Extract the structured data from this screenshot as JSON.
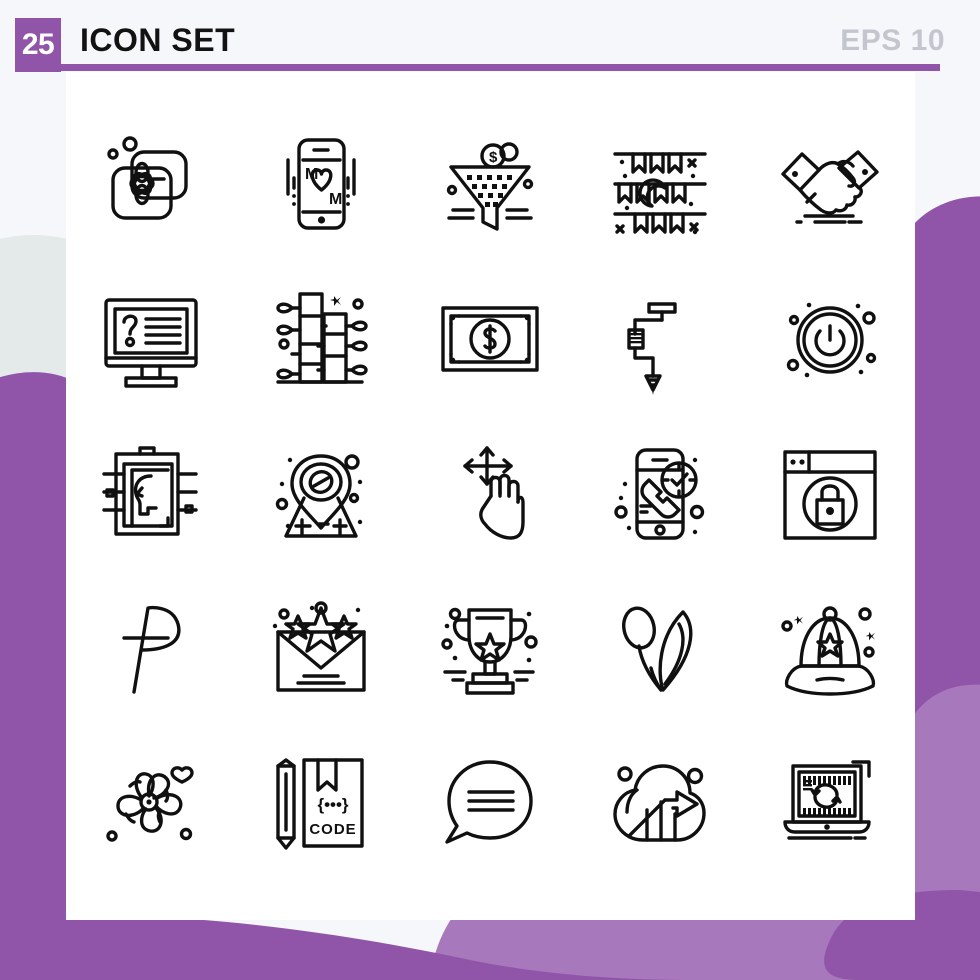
{
  "header": {
    "count_badge": "25",
    "title": "ICON SET",
    "format_label": "EPS 10"
  },
  "theme": {
    "accent": "#9055a8",
    "accent_light": "#a878bd",
    "page_bg": "#f6f7fb",
    "card_bg": "#ffffff",
    "stroke": "#101010",
    "muted_text": "#c3c6cf",
    "blob_gray": "#e4e9ea"
  },
  "grid": {
    "columns": 5,
    "rows": 5,
    "total": 25
  },
  "icons": [
    {
      "row": 1,
      "col": 1,
      "name": "soap-bars-flower-icon",
      "label": "Soap"
    },
    {
      "row": 1,
      "col": 2,
      "name": "mobile-dating-heart-icon",
      "label": "Mobile Love"
    },
    {
      "row": 1,
      "col": 3,
      "name": "money-funnel-icon",
      "label": "Sales Funnel"
    },
    {
      "row": 1,
      "col": 4,
      "name": "bunting-moon-decoration-icon",
      "label": "Decoration"
    },
    {
      "row": 1,
      "col": 5,
      "name": "handshake-icon",
      "label": "Handshake"
    },
    {
      "row": 2,
      "col": 1,
      "name": "monitor-faq-icon",
      "label": "FAQ"
    },
    {
      "row": 2,
      "col": 2,
      "name": "sugarcane-plant-icon",
      "label": "Sugarcane"
    },
    {
      "row": 2,
      "col": 3,
      "name": "dollar-banknote-icon",
      "label": "Money"
    },
    {
      "row": 2,
      "col": 4,
      "name": "tattoo-machine-icon",
      "label": "Tattoo Machine"
    },
    {
      "row": 2,
      "col": 5,
      "name": "power-button-icon",
      "label": "Power"
    },
    {
      "row": 3,
      "col": 1,
      "name": "clipboard-profile-icon",
      "label": "Report"
    },
    {
      "row": 3,
      "col": 2,
      "name": "map-location-pin-icon",
      "label": "Location"
    },
    {
      "row": 3,
      "col": 3,
      "name": "hand-move-gesture-icon",
      "label": "Drag Gesture"
    },
    {
      "row": 3,
      "col": 4,
      "name": "phone-call-clock-icon",
      "label": "Call Time"
    },
    {
      "row": 3,
      "col": 5,
      "name": "browser-lock-icon",
      "label": "Secure Web"
    },
    {
      "row": 4,
      "col": 1,
      "name": "ruble-currency-icon",
      "label": "Ruble"
    },
    {
      "row": 4,
      "col": 2,
      "name": "envelope-stars-icon",
      "label": "Favorite Mail"
    },
    {
      "row": 4,
      "col": 3,
      "name": "trophy-icon",
      "label": "Trophy"
    },
    {
      "row": 4,
      "col": 4,
      "name": "tulip-leaves-icon",
      "label": "Tulip"
    },
    {
      "row": 4,
      "col": 5,
      "name": "baseball-cap-star-icon",
      "label": "Cap"
    },
    {
      "row": 5,
      "col": 1,
      "name": "flower-pinwheel-icon",
      "label": "Flower"
    },
    {
      "row": 5,
      "col": 2,
      "name": "code-document-pencil-icon",
      "label": "Coding"
    },
    {
      "row": 5,
      "col": 3,
      "name": "speech-bubble-icon",
      "label": "Chat"
    },
    {
      "row": 5,
      "col": 4,
      "name": "cloud-growth-arrow-icon",
      "label": "Cloud Growth"
    },
    {
      "row": 5,
      "col": 5,
      "name": "laptop-sync-icon",
      "label": "Laptop Sync"
    }
  ],
  "icon_text": {
    "code_label": "CODE",
    "code_braces": "{•••}",
    "dollar_sign": "$",
    "phone_letter_left": "M",
    "phone_letter_right": "M"
  }
}
